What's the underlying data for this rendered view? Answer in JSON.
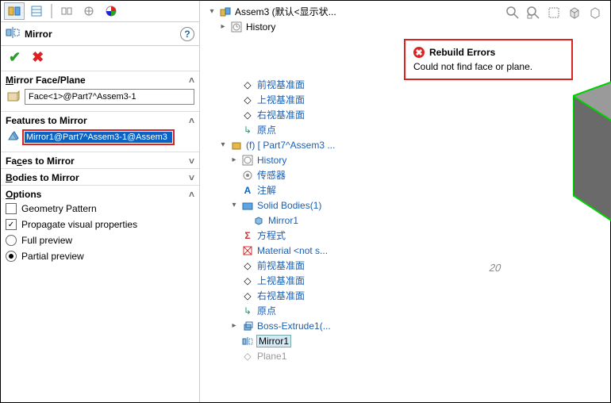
{
  "panel": {
    "command_title": "Mirror",
    "sections": {
      "mirror_face_plane": "Mirror Face/Plane",
      "features_to_mirror": "Features to Mirror",
      "faces_to_mirror": "Faces to Mirror",
      "bodies_to_mirror": "Bodies to Mirror",
      "options": "Options"
    },
    "mirror_face_value": "Face<1>@Part7^Assem3-1",
    "features_list": [
      "Mirror1@Part7^Assem3-1@Assem3"
    ],
    "options_items": {
      "geometry_pattern": "Geometry Pattern",
      "propagate_visual": "Propagate visual properties",
      "full_preview": "Full preview",
      "partial_preview": "Partial preview"
    }
  },
  "balloon": {
    "title": "Rebuild Errors",
    "msg": "Could not find face or plane."
  },
  "tree": {
    "root": "Assem3  (默认<显示状...",
    "history": "History",
    "cut_line": "前视基准面",
    "top_plane": "上视基准面",
    "right_plane": "右视基准面",
    "origin": "原点",
    "part": "(f) [ Part7^Assem3 ...",
    "history2": "History",
    "sensors": "传感器",
    "annotations": "注解",
    "solid_bodies": "Solid Bodies(1)",
    "solid_bodies_child": "Mirror1",
    "equations": "方程式",
    "material": "Material <not s...",
    "front_plane": "前视基准面",
    "top_plane2": "上视基准面",
    "right_plane2": "右视基准面",
    "origin2": "原点",
    "boss_extrude": "Boss-Extrude1(...",
    "mirror1": "Mirror1",
    "plane1": "Plane1"
  },
  "dim": "20"
}
